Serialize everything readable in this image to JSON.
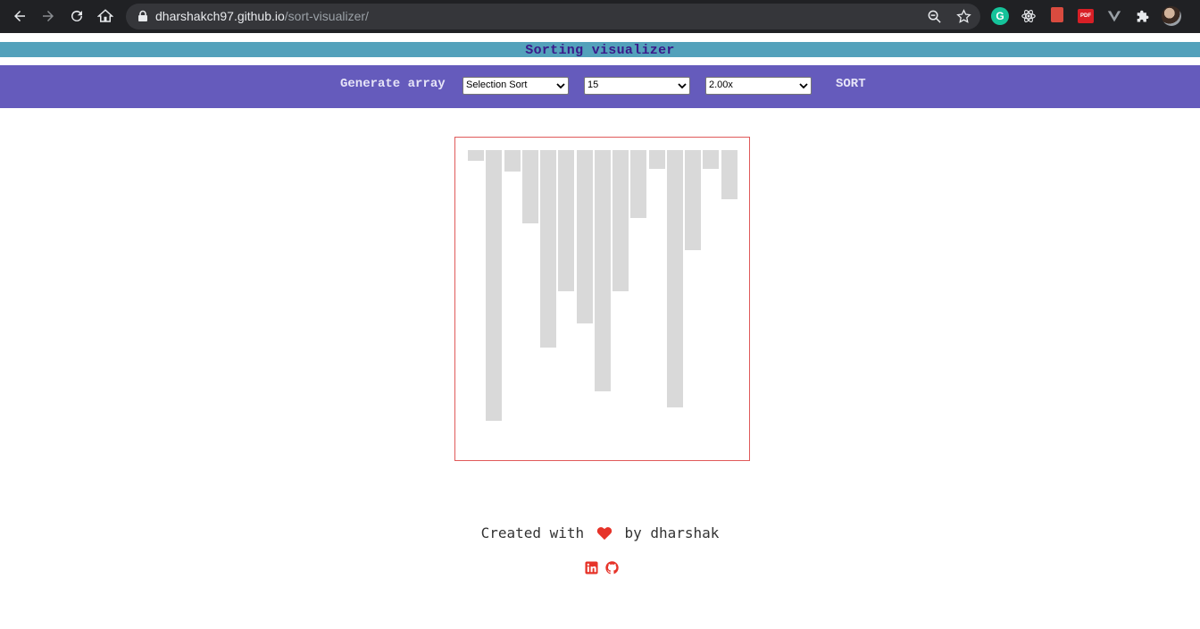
{
  "browser": {
    "url_host": "dharshakch97.github.io",
    "url_path": "/sort-visualizer/",
    "extensions": [
      {
        "name": "grammarly",
        "label": "G"
      },
      {
        "name": "react-devtools",
        "label": ""
      },
      {
        "name": "bookmark-ext",
        "label": ""
      },
      {
        "name": "pdf-ext",
        "label": "PDF"
      },
      {
        "name": "vue-devtools",
        "label": ""
      }
    ]
  },
  "app": {
    "title": "Sorting visualizer",
    "generate_label": "Generate array",
    "algorithm_select": "Selection Sort",
    "size_select": "15",
    "speed_select": "2.00x",
    "sort_label": "SORT",
    "bar_color": "#d9d9d9",
    "box_border_color": "#e05a5a",
    "bars": [
      4,
      100,
      8,
      27,
      73,
      52,
      64,
      89,
      52,
      25,
      7,
      95,
      37,
      7,
      18
    ]
  },
  "footer": {
    "prefix": "Created with",
    "suffix": "by dharshak",
    "heart_color": "#e63329",
    "links": [
      "linkedin-icon",
      "github-icon"
    ]
  }
}
